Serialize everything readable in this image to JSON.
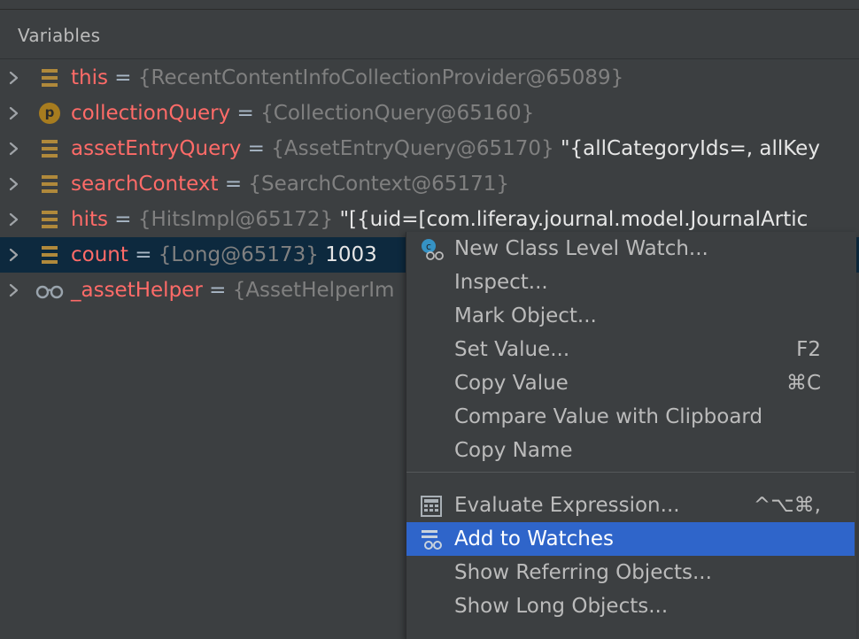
{
  "panel": {
    "title": "Variables"
  },
  "variables": [
    {
      "icon": "field-icon",
      "name": "this",
      "eq": " = ",
      "type": "{RecentContentInfoCollectionProvider@65089}",
      "value": ""
    },
    {
      "icon": "parameter-icon",
      "icon_letter": "p",
      "name": "collectionQuery",
      "eq": " = ",
      "type": "{CollectionQuery@65160}",
      "value": ""
    },
    {
      "icon": "field-icon",
      "name": "assetEntryQuery",
      "eq": " = ",
      "type": "{AssetEntryQuery@65170}",
      "value": " \"{allCategoryIds=, allKey"
    },
    {
      "icon": "field-icon",
      "name": "searchContext",
      "eq": " = ",
      "type": "{SearchContext@65171}",
      "value": ""
    },
    {
      "icon": "field-icon",
      "name": "hits",
      "eq": " = ",
      "type": "{HitsImpl@65172}",
      "value": " \"[{uid=[com.liferay.journal.model.JournalArtic"
    },
    {
      "icon": "field-icon",
      "name": "count",
      "eq": " = ",
      "type": "{Long@65173}",
      "value": " 1003",
      "selected": true
    },
    {
      "icon": "watch-icon",
      "name": "_assetHelper",
      "eq": " = ",
      "type": "{AssetHelperIm",
      "value": ""
    }
  ],
  "menu": {
    "items": [
      {
        "label": "New Class Level Watch...",
        "shortcut": "",
        "icon": "class-watch-icon",
        "icon_letter": "c"
      },
      {
        "label": "Inspect...",
        "shortcut": "",
        "icon": ""
      },
      {
        "label": "Mark Object...",
        "shortcut": "",
        "icon": ""
      },
      {
        "label": "Set Value...",
        "shortcut": "F2",
        "icon": ""
      },
      {
        "label": "Copy Value",
        "shortcut": "⌘C",
        "icon": ""
      },
      {
        "label": "Compare Value with Clipboard",
        "shortcut": "",
        "icon": ""
      },
      {
        "label": "Copy Name",
        "shortcut": "",
        "icon": ""
      },
      {
        "label": "Evaluate Expression...",
        "shortcut": "^⌥⌘,",
        "icon": "calculator-icon"
      },
      {
        "label": "Add to Watches",
        "shortcut": "",
        "icon": "add-watch-icon",
        "highlight": true
      },
      {
        "label": "Show Referring Objects...",
        "shortcut": "",
        "icon": ""
      },
      {
        "label": "Show Long Objects...",
        "shortcut": "",
        "icon": ""
      }
    ]
  },
  "colors": {
    "background": "#3c3f41",
    "selection": "#0d293e",
    "menu_highlight": "#2f65ca",
    "var_name": "#ff6b68",
    "type_text": "#808080",
    "field_icon": "#b0893b"
  }
}
